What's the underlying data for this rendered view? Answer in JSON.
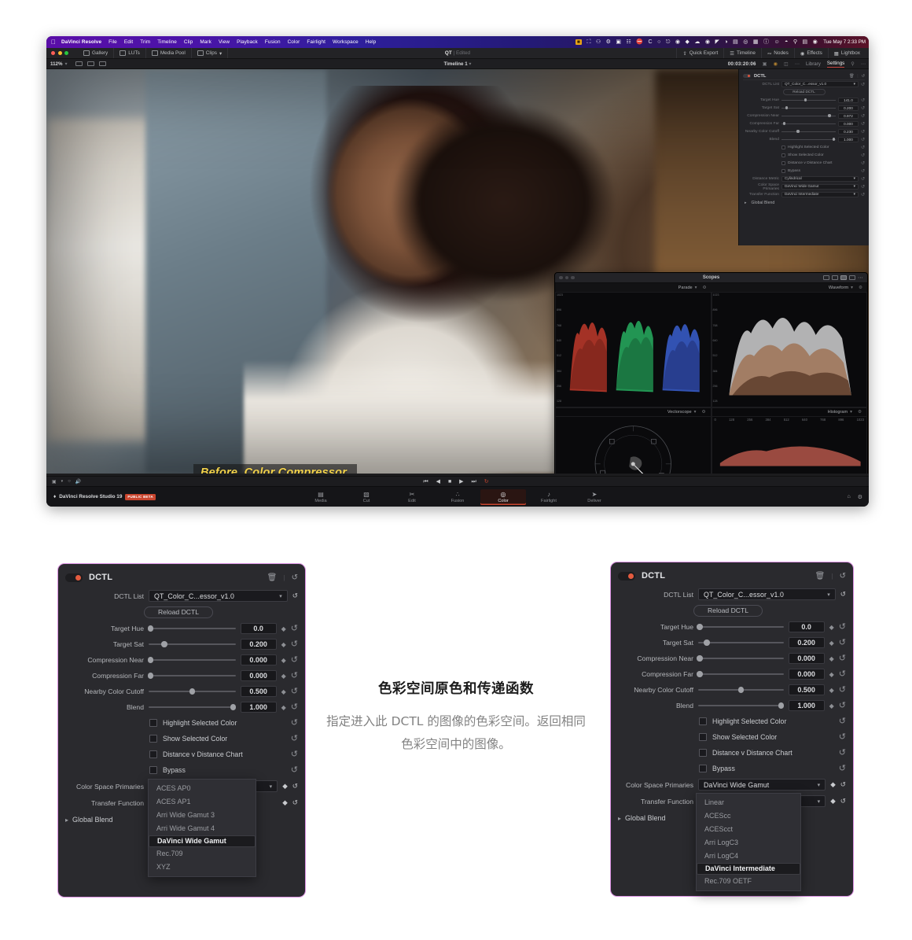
{
  "os": {
    "menubar": {
      "apple_icon": "apple-icon",
      "app_name": "DaVinci Resolve",
      "menus": [
        "File",
        "Edit",
        "Trim",
        "Timeline",
        "Clip",
        "Mark",
        "View",
        "Playback",
        "Fusion",
        "Color",
        "Fairlight",
        "Workspace",
        "Help"
      ],
      "status_icons": [
        "screen-recording-icon",
        "battery-icon",
        "gear-icon",
        "display-icon",
        "clipboard-icon",
        "shield-icon",
        "c-icon",
        "clock-icon",
        "duplicate-icon",
        "globe-icon",
        "dropbox-icon",
        "cloud-icon",
        "at-icon",
        "cursor-icon",
        "contrast-icon",
        "columns-icon",
        "target-icon",
        "door-icon",
        "info-icon",
        "emoji-icon",
        "wifi-icon",
        "search-icon",
        "control-center-icon",
        "siri-icon"
      ],
      "clock": "Tue May 7  2:33 PM"
    }
  },
  "resolve": {
    "toolbar_top": {
      "left_buttons": [
        "Gallery",
        "LUTs",
        "Media Pool",
        "Clips"
      ],
      "center_title": "QT",
      "center_status": "Edited",
      "right_buttons": [
        "Quick Export",
        "Timeline",
        "Nodes",
        "Effects",
        "Lightbox"
      ]
    },
    "toolbar_second": {
      "zoom_level": "112%",
      "timeline_name": "Timeline 1",
      "timecode": "00:03:20:06",
      "tabs": [
        "Library",
        "Settings"
      ],
      "active_tab": "Settings"
    },
    "viewer": {
      "subtitle_overlay": "Before, Color Compressor."
    },
    "inspector": {
      "title": "DCTL",
      "dctl_list_label": "DCTL List",
      "dctl_list_value": "QT_Color_C...essor_v1.0",
      "reload_label": "Reload DCTL",
      "params": [
        {
          "label": "Target Hue",
          "value": "141.0",
          "knob": 42
        },
        {
          "label": "Target Sat",
          "value": "0.200",
          "knob": 7
        },
        {
          "label": "Compression Near",
          "value": "0.972",
          "knob": 86
        },
        {
          "label": "Compression Far",
          "value": "0.000",
          "knob": 3
        },
        {
          "label": "Nearby Color Cutoff",
          "value": "0.230",
          "knob": 28
        },
        {
          "label": "Blend",
          "value": "1.000",
          "knob": 94
        }
      ],
      "checkboxes": [
        "Highlight Selected Color",
        "Show Selected Color",
        "Distance v Distance Chart",
        "Bypass"
      ],
      "dropdowns": [
        {
          "label": "Distance Metric",
          "value": "Cylindrical"
        },
        {
          "label": "Color Space Primaries",
          "value": "DaVinci Wide Gamut"
        },
        {
          "label": "Transfer Function",
          "value": "DaVinci Intermediate"
        }
      ],
      "global_blend": "Global Blend"
    },
    "scopes": {
      "window_title": "Scopes",
      "top_left": "Parade",
      "top_right": "Waveform",
      "bottom_left": "Vectorscope",
      "bottom_right": "Histogram",
      "parade_axis": [
        "1023",
        "896",
        "768",
        "640",
        "512",
        "384",
        "256",
        "128"
      ],
      "waveform_axis": [
        "1023",
        "896",
        "768",
        "640",
        "512",
        "384",
        "256",
        "128"
      ],
      "histogram_ruler": [
        "0",
        "128",
        "256",
        "384",
        "512",
        "640",
        "768",
        "896",
        "1023"
      ]
    },
    "transport": {
      "buttons": [
        "first-frame-icon",
        "step-back-icon",
        "stop-icon",
        "play-icon",
        "last-frame-icon",
        "loop-icon"
      ],
      "left_icons": [
        "viewer-mode-icon",
        "timer-icon",
        "speaker-icon"
      ]
    },
    "pagebar": {
      "product": "DaVinci Resolve Studio 19",
      "badge": "PUBLIC BETA",
      "pages": [
        {
          "label": "Media",
          "icon": "media-icon"
        },
        {
          "label": "Cut",
          "icon": "cut-icon"
        },
        {
          "label": "Edit",
          "icon": "edit-icon"
        },
        {
          "label": "Fusion",
          "icon": "fusion-icon"
        },
        {
          "label": "Color",
          "icon": "color-icon"
        },
        {
          "label": "Fairlight",
          "icon": "fairlight-icon"
        },
        {
          "label": "Deliver",
          "icon": "deliver-icon"
        }
      ],
      "active_page": "Color",
      "right_icons": [
        "home-icon",
        "gear-icon"
      ]
    }
  },
  "panel_left": {
    "title": "DCTL",
    "toolbar_icons": [
      "trash-icon",
      "reset-icon"
    ],
    "dctl_list_label": "DCTL List",
    "dctl_list_value": "QT_Color_C...essor_v1.0",
    "reload_label": "Reload DCTL",
    "params": [
      {
        "label": "Target Hue",
        "value": "0.0",
        "knob_pct": 2
      },
      {
        "label": "Target Sat",
        "value": "0.200",
        "knob_pct": 18
      },
      {
        "label": "Compression Near",
        "value": "0.000",
        "knob_pct": 2
      },
      {
        "label": "Compression Far",
        "value": "0.000",
        "knob_pct": 2
      },
      {
        "label": "Nearby Color Cutoff",
        "value": "0.500",
        "knob_pct": 50
      },
      {
        "label": "Blend",
        "value": "1.000",
        "knob_pct": 97
      }
    ],
    "checkboxes": [
      "Highlight Selected Color",
      "Show Selected Color",
      "Distance v Distance Chart",
      "Bypass"
    ],
    "color_space_primaries_label": "Color Space Primaries",
    "color_space_primaries_value": "DaVinci Wide Gamut",
    "transfer_function_label": "Transfer Function",
    "transfer_function_value": "",
    "global_blend_label": "Global Blend",
    "open_dropdown": {
      "name": "color-space-primaries",
      "options": [
        "ACES AP0",
        "ACES AP1",
        "Arri Wide Gamut 3",
        "Arri Wide Gamut 4",
        "DaVinci Wide Gamut",
        "Rec.709",
        "XYZ"
      ],
      "selected": "DaVinci Wide Gamut"
    }
  },
  "panel_right": {
    "title": "DCTL",
    "toolbar_icons": [
      "trash-icon",
      "reset-icon"
    ],
    "dctl_list_label": "DCTL List",
    "dctl_list_value": "QT_Color_C...essor_v1.0",
    "reload_label": "Reload DCTL",
    "params": [
      {
        "label": "Target Hue",
        "value": "0.0",
        "knob_pct": 2
      },
      {
        "label": "Target Sat",
        "value": "0.200",
        "knob_pct": 10
      },
      {
        "label": "Compression Near",
        "value": "0.000",
        "knob_pct": 2
      },
      {
        "label": "Compression Far",
        "value": "0.000",
        "knob_pct": 2
      },
      {
        "label": "Nearby Color Cutoff",
        "value": "0.500",
        "knob_pct": 50
      },
      {
        "label": "Blend",
        "value": "1.000",
        "knob_pct": 97
      }
    ],
    "checkboxes": [
      "Highlight Selected Color",
      "Show Selected Color",
      "Distance v Distance Chart",
      "Bypass"
    ],
    "color_space_primaries_label": "Color Space Primaries",
    "color_space_primaries_value": "DaVinci Wide Gamut",
    "transfer_function_label": "Transfer Function",
    "transfer_function_value": "DaVinci Intermediate",
    "global_blend_label": "Global Blend",
    "open_dropdown": {
      "name": "transfer-function",
      "options": [
        "Linear",
        "ACEScc",
        "ACEScct",
        "Arri LogC3",
        "Arri LogC4",
        "DaVinci Intermediate",
        "Rec.709 OETF"
      ],
      "selected": "DaVinci Intermediate"
    }
  },
  "center_text": {
    "heading": "色彩空间原色和传递函数",
    "body": "指定进入此 DCTL 的图像的色彩空间。返回相同色彩空间中的图像。"
  },
  "colors": {
    "panel_border": "#d98fe0",
    "panel_bg": "#2a2a2e",
    "accent_red": "#c9452e",
    "subtitle_yellow": "#f2d24b",
    "toggle_dot": "#e45b3f"
  }
}
